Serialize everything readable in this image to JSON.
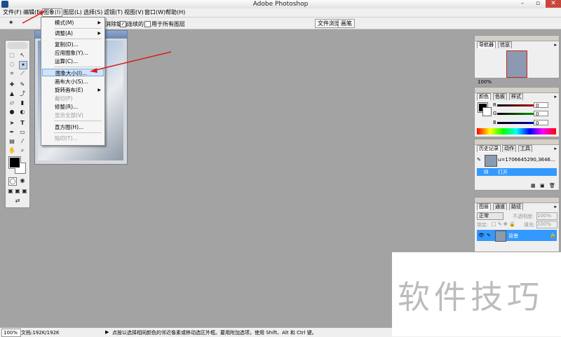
{
  "window": {
    "title": "Adobe Photoshop"
  },
  "menubar": {
    "items": [
      "文件(F)",
      "编辑(E)",
      "图象(I)",
      "图层(L)",
      "选择(S)",
      "滤镜(T)",
      "视图(V)",
      "窗口(W)",
      "帮助(H)"
    ]
  },
  "optionsbar": {
    "item1": "消除锯齿",
    "item2": "连续的",
    "item3": "用于所有图层",
    "tab_file_browser": "文件浏览",
    "tab_brush": "画笔"
  },
  "dropdown": {
    "items": [
      "模式(M)",
      "调整(A)",
      "复制(D)...",
      "应用图象(Y)...",
      "运算(C)...",
      "图象大小(I)...",
      "画布大小(S)...",
      "旋转画布(E)",
      "裁切(P)",
      "修整(R)...",
      "显示全部(V)",
      "直方图(H)...",
      "陷印(T)..."
    ]
  },
  "navigator": {
    "tabs": [
      "导航器",
      "信息"
    ],
    "zoom": "100%"
  },
  "color": {
    "tabs": [
      "颜色",
      "色板",
      "样式"
    ],
    "channels": [
      {
        "label": "R",
        "value": "0"
      },
      {
        "label": "G",
        "value": "0"
      },
      {
        "label": "B",
        "value": "0"
      }
    ]
  },
  "history": {
    "tabs": [
      "历史记录",
      "动作",
      "工具"
    ],
    "snapshot": "u=1706645290,3646...",
    "step": "打开"
  },
  "layers": {
    "tabs": [
      "图层",
      "通道",
      "路径"
    ],
    "mode": "正常",
    "opacity_label": "不透明度:",
    "opacity": "100%",
    "lock_label": "锁定:",
    "fill_label": "填充:",
    "fill": "100%",
    "layer_name": "背景"
  },
  "statusbar": {
    "zoom": "100%",
    "doc": "文档:192K/192K",
    "hint": "点按以选择相同颜色的邻近像素或移动选区外框。要用附加选项，使用 Shift、Alt 和 Ctrl 键。"
  },
  "watermark": "软件技巧",
  "colors": {
    "accent": "#3399ff",
    "arrow": "#d62020",
    "menu_highlight": "#cfe3fb"
  }
}
